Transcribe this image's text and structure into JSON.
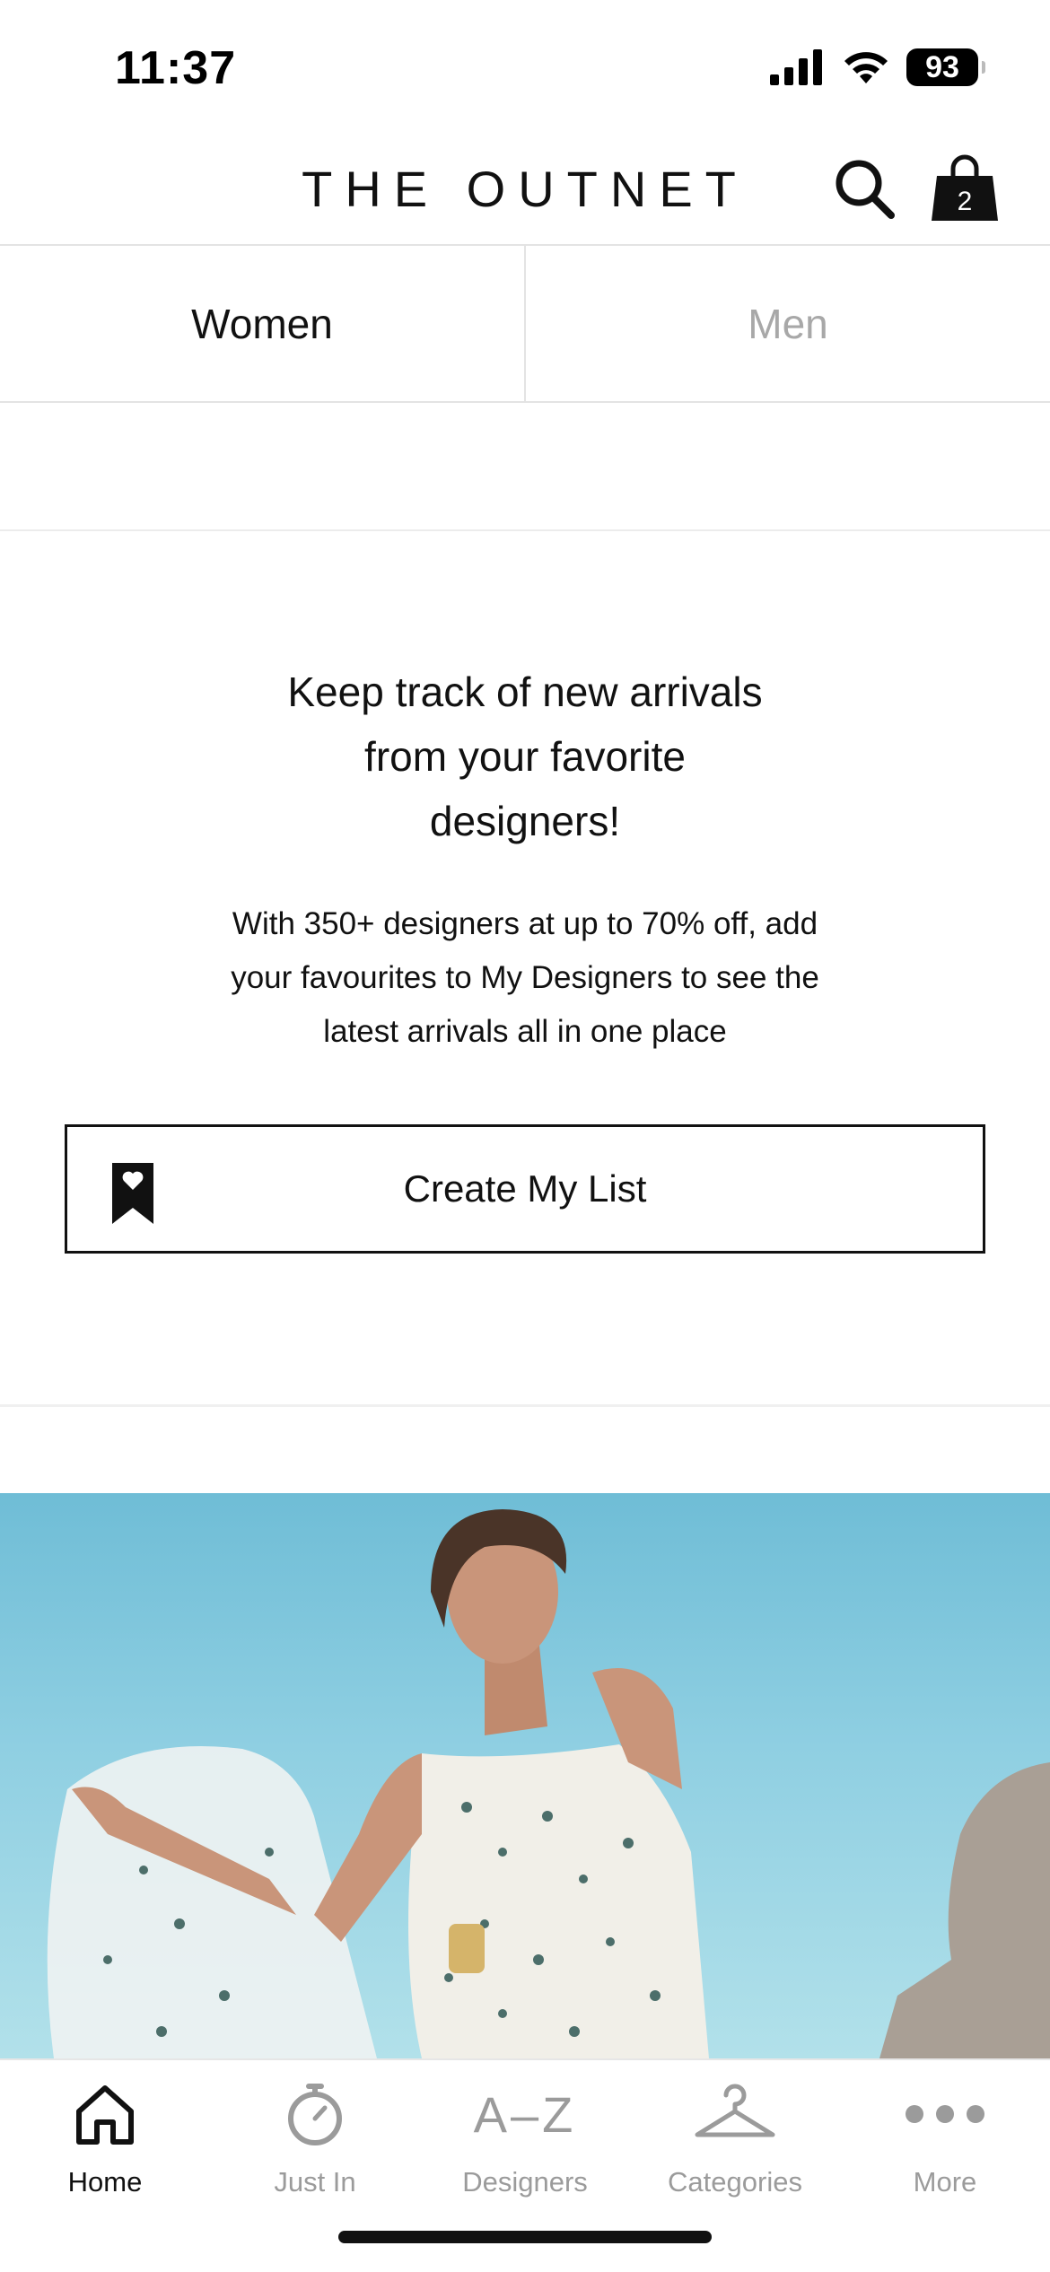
{
  "status_bar": {
    "time": "11:37",
    "battery": "93"
  },
  "header": {
    "logo": "THE OUTNET",
    "bag_count": "2"
  },
  "tabs": [
    {
      "label": "Women",
      "active": true
    },
    {
      "label": "Men",
      "active": false
    }
  ],
  "promo": {
    "title_line1": "Keep track of new arrivals",
    "title_line2": "from your favorite",
    "title_line3": "designers!",
    "body_line1": "With 350+ designers at up to 70% off, add",
    "body_line2": "your favourites to My Designers to see the",
    "body_line3": "latest arrivals all in one place",
    "cta_label": "Create My List"
  },
  "bottom_nav": [
    {
      "label": "Home",
      "icon": "home-icon",
      "active": true
    },
    {
      "label": "Just In",
      "icon": "stopwatch-icon",
      "active": false
    },
    {
      "label": "Designers",
      "icon": "a-z-icon",
      "glyph": "A–Z",
      "active": false
    },
    {
      "label": "Categories",
      "icon": "hanger-icon",
      "active": false
    },
    {
      "label": "More",
      "icon": "more-icon",
      "active": false
    }
  ],
  "colors": {
    "text": "#111111",
    "inactive": "#9b9b9b",
    "divider": "#e3e3e3",
    "sky": "#8fcfe2"
  }
}
